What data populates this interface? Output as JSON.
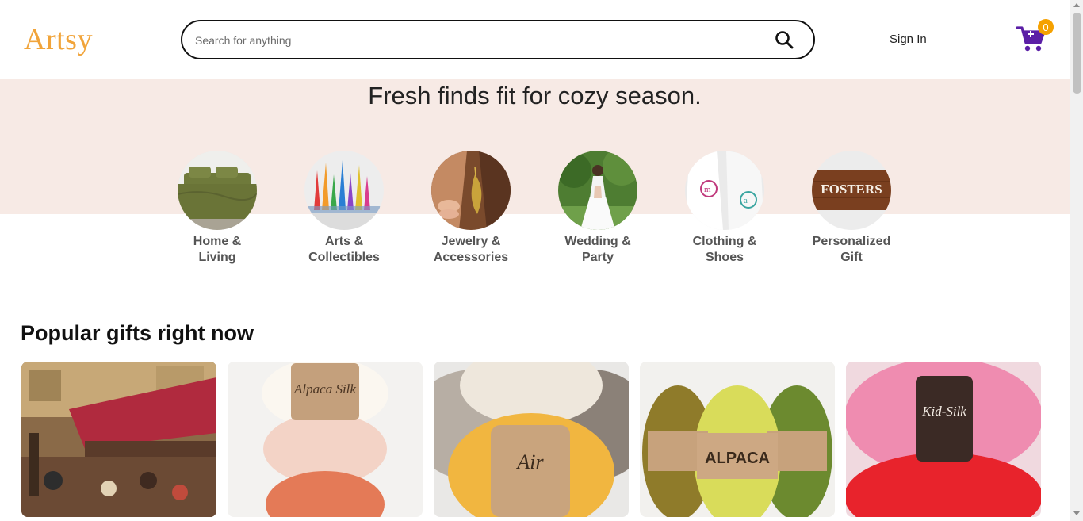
{
  "header": {
    "logo": "Artsy",
    "search_placeholder": "Search for anything",
    "sign_in": "Sign In",
    "cart_count": "0"
  },
  "hero": {
    "title": "Fresh finds fit for cozy season."
  },
  "categories": [
    {
      "line1": "Home &",
      "line2": "Living",
      "icon": "bedroom-photo"
    },
    {
      "line1": "Arts &",
      "line2": "Collectibles",
      "icon": "painting-photo"
    },
    {
      "line1": "Jewelry &",
      "line2": "Accessories",
      "icon": "earring-photo"
    },
    {
      "line1": "Wedding &",
      "line2": "Party",
      "icon": "bride-photo"
    },
    {
      "line1": "Clothing &",
      "line2": "Shoes",
      "icon": "embroidered-shirt-photo"
    },
    {
      "line1": "Personalized",
      "line2": "Gift",
      "icon": "wood-sign-photo"
    }
  ],
  "popular": {
    "title": "Popular gifts right now",
    "products": [
      {
        "image": "cafe-painting-photo",
        "label_text": ""
      },
      {
        "image": "alpaca-silk-yarn-photo",
        "label_text": "Alpaca Silk"
      },
      {
        "image": "air-yarn-photo",
        "label_text": "Air"
      },
      {
        "image": "alpaca-yarn-photo",
        "label_text": "ALPACA"
      },
      {
        "image": "kid-silk-yarn-photo",
        "label_text": "Kid-Silk"
      }
    ]
  },
  "colors": {
    "logo": "#f1a43a",
    "hero_bg": "#f7eae5",
    "cart": "#5b1fa6",
    "badge": "#f5a100"
  }
}
